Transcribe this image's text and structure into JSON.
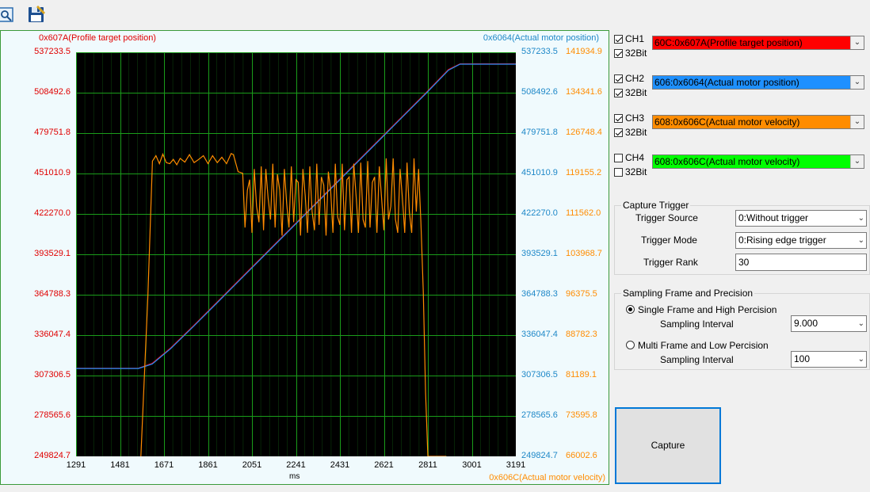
{
  "toolbar": {
    "open_icon": "open-waveform-icon",
    "save_icon": "save-icon"
  },
  "plot": {
    "left_axis_title": "0x607A(Profile target position)",
    "right_axis_title1": "0x6064(Actual motor position)",
    "right_axis_title2": "0x606C(Actual motor velocity)",
    "x_unit": "ms",
    "colors": {
      "ch1": "#ff0000",
      "ch2": "#1e90ff",
      "ch3": "#ff8c00",
      "grid": "#1a9c1a",
      "bg": "#000000"
    },
    "left_ticks": [
      "537233.5",
      "508492.6",
      "479751.8",
      "451010.9",
      "422270.0",
      "393529.1",
      "364788.3",
      "336047.4",
      "307306.5",
      "278565.6",
      "249824.7"
    ],
    "right_ticks1": [
      "537233.5",
      "508492.6",
      "479751.8",
      "451010.9",
      "422270.0",
      "393529.1",
      "364788.3",
      "336047.4",
      "307306.5",
      "278565.6",
      "249824.7"
    ],
    "right_ticks2": [
      "141934.9",
      "134341.6",
      "126748.4",
      "119155.2",
      "111562.0",
      "103968.7",
      "96375.5",
      "88782.3",
      "81189.1",
      "73595.8",
      "66002.6"
    ],
    "x_ticks": [
      "1291",
      "1481",
      "1671",
      "1861",
      "2051",
      "2241",
      "2431",
      "2621",
      "2811",
      "3001",
      "3191"
    ]
  },
  "chart_data": {
    "type": "line",
    "xlabel": "ms",
    "xlim": [
      1291,
      3191
    ],
    "y_left": {
      "label": "0x607A(Profile target position)",
      "ylim": [
        249824.7,
        537233.5
      ]
    },
    "y_right1": {
      "label": "0x6064(Actual motor position)",
      "ylim": [
        249824.7,
        537233.5
      ]
    },
    "y_right2": {
      "label": "0x606C(Actual motor velocity)",
      "ylim": [
        66002.6,
        141934.9
      ]
    },
    "grid": true,
    "series": [
      {
        "name": "0x607A(Profile target position)",
        "axis": "left",
        "color": "#ff0000",
        "x": [
          1291,
          1560,
          1620,
          1700,
          1800,
          1900,
          2000,
          2100,
          2200,
          2300,
          2400,
          2500,
          2600,
          2700,
          2800,
          2900,
          2950,
          3191
        ],
        "y": [
          312500,
          312500,
          316000,
          327000,
          343000,
          359500,
          376000,
          392500,
          409000,
          425500,
          442000,
          458500,
          475000,
          491500,
          508000,
          525000,
          529000,
          529000
        ]
      },
      {
        "name": "0x6064(Actual motor position)",
        "axis": "right1",
        "color": "#1e90ff",
        "x": [
          1291,
          1560,
          1620,
          1700,
          1800,
          1900,
          2000,
          2100,
          2200,
          2300,
          2400,
          2500,
          2600,
          2700,
          2800,
          2900,
          2950,
          3191
        ],
        "y": [
          312300,
          312300,
          315500,
          326500,
          342500,
          359000,
          375500,
          392000,
          408500,
          425000,
          441500,
          458000,
          474500,
          491000,
          507500,
          524500,
          528800,
          528800
        ]
      },
      {
        "name": "0x606C(Actual motor velocity)",
        "axis": "right2",
        "color": "#ff8c00",
        "x": [
          1571,
          1601,
          1621,
          1636,
          1651,
          1666,
          1681,
          1696,
          1711,
          1726,
          1741,
          1761,
          1781,
          1801,
          1821,
          1841,
          1861,
          1881,
          1901,
          1921,
          1941,
          1961,
          1971,
          1991,
          2011,
          2021,
          2031,
          2041,
          2051,
          2061,
          2071,
          2081,
          2091,
          2101,
          2111,
          2121,
          2131,
          2141,
          2151,
          2161,
          2171,
          2181,
          2191,
          2201,
          2211,
          2221,
          2231,
          2241,
          2251,
          2261,
          2271,
          2281,
          2291,
          2301,
          2311,
          2321,
          2331,
          2341,
          2351,
          2361,
          2371,
          2381,
          2391,
          2401,
          2411,
          2421,
          2431,
          2441,
          2451,
          2461,
          2471,
          2481,
          2491,
          2501,
          2511,
          2521,
          2531,
          2541,
          2551,
          2561,
          2571,
          2581,
          2591,
          2601,
          2611,
          2621,
          2631,
          2641,
          2651,
          2661,
          2671,
          2681,
          2691,
          2701,
          2711,
          2721,
          2731,
          2741,
          2751,
          2761,
          2771,
          2781,
          2791,
          2801,
          2811,
          2821,
          2831,
          2841,
          2851,
          2861,
          2871,
          2881,
          2891
        ],
        "y": [
          66002,
          96000,
          121500,
          122500,
          121000,
          122800,
          121200,
          121000,
          121800,
          120800,
          122000,
          121300,
          122700,
          121200,
          121800,
          122500,
          121000,
          122500,
          121200,
          122200,
          121000,
          122900,
          122700,
          119500,
          119200,
          109000,
          116000,
          118000,
          108000,
          120000,
          113000,
          110000,
          120500,
          108500,
          120000,
          114500,
          110500,
          121000,
          109000,
          119000,
          116000,
          107500,
          120000,
          113500,
          109000,
          120500,
          110000,
          118000,
          117500,
          107500,
          120000,
          115000,
          108000,
          120500,
          112000,
          108500,
          121000,
          109500,
          118500,
          117000,
          107500,
          119500,
          116000,
          108000,
          121000,
          111000,
          109500,
          121000,
          108500,
          118000,
          118500,
          108000,
          121000,
          115000,
          108000,
          121200,
          110500,
          109000,
          121500,
          109000,
          117500,
          118500,
          108000,
          120500,
          114500,
          108500,
          122000,
          110500,
          113000,
          122000,
          110500,
          108000,
          120000,
          114500,
          108000,
          121200,
          112000,
          108000,
          122000,
          112000,
          120000,
          110000,
          97000,
          78000,
          66002,
          66002,
          66002,
          66002,
          66002,
          66002,
          66002,
          66002,
          66002
        ]
      }
    ]
  },
  "channels": [
    {
      "label": "CH1",
      "checked": true,
      "bit_label": "32Bit",
      "bit_checked": true,
      "value": "60C:0x607A(Profile target position)",
      "color": "#ff0000",
      "text_color": "#000000"
    },
    {
      "label": "CH2",
      "checked": true,
      "bit_label": "32Bit",
      "bit_checked": true,
      "value": "606:0x6064(Actual motor position)",
      "color": "#1e90ff",
      "text_color": "#000000"
    },
    {
      "label": "CH3",
      "checked": true,
      "bit_label": "32Bit",
      "bit_checked": true,
      "value": "608:0x606C(Actual motor velocity)",
      "color": "#ff8c00",
      "text_color": "#000000"
    },
    {
      "label": "CH4",
      "checked": false,
      "bit_label": "32Bit",
      "bit_checked": false,
      "value": "608:0x606C(Actual motor velocity)",
      "color": "#00ff00",
      "text_color": "#000000"
    }
  ],
  "capture_trigger": {
    "title": "Capture Trigger",
    "source_label": "Trigger Source",
    "source_value": "0:Without trigger",
    "mode_label": "Trigger Mode",
    "mode_value": "0:Rising edge trigger",
    "rank_label": "Trigger Rank",
    "rank_value": "30"
  },
  "sampling": {
    "title": "Sampling Frame and Precision",
    "single_label": "Single Frame and High Percision",
    "single_selected": true,
    "single_interval_label": "Sampling Interval",
    "single_interval_value": "9.000",
    "multi_label": "Multi Frame and Low Percision",
    "multi_selected": false,
    "multi_interval_label": "Sampling Interval",
    "multi_interval_value": "100"
  },
  "capture_button": {
    "label": "Capture"
  }
}
